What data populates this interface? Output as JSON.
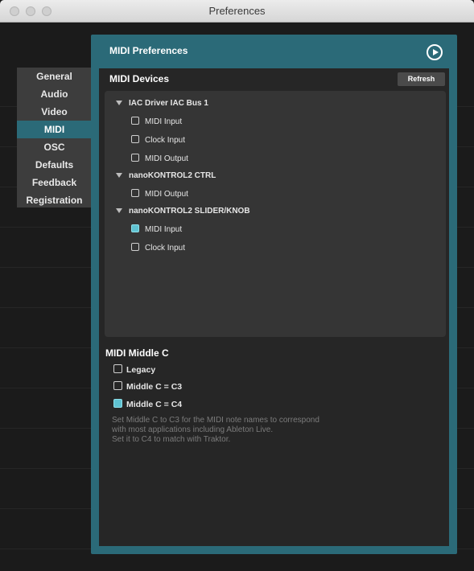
{
  "window": {
    "title": "Preferences"
  },
  "sidebar": {
    "items": [
      {
        "label": "General",
        "active": false
      },
      {
        "label": "Audio",
        "active": false
      },
      {
        "label": "Video",
        "active": false
      },
      {
        "label": "MIDI",
        "active": true
      },
      {
        "label": "OSC",
        "active": false
      },
      {
        "label": "Defaults",
        "active": false
      },
      {
        "label": "Feedback",
        "active": false
      },
      {
        "label": "Registration",
        "active": false
      }
    ]
  },
  "panel": {
    "title": "MIDI Preferences",
    "devices_label": "MIDI Devices",
    "refresh_label": "Refresh",
    "devices": [
      {
        "name": "IAC Driver IAC Bus 1",
        "options": [
          {
            "label": "MIDI Input",
            "checked": false
          },
          {
            "label": "Clock Input",
            "checked": false
          },
          {
            "label": "MIDI Output",
            "checked": false
          }
        ]
      },
      {
        "name": "nanoKONTROL2 CTRL",
        "options": [
          {
            "label": "MIDI Output",
            "checked": false
          }
        ]
      },
      {
        "name": "nanoKONTROL2 SLIDER/KNOB",
        "options": [
          {
            "label": "MIDI Input",
            "checked": true
          },
          {
            "label": "Clock Input",
            "checked": false
          }
        ]
      }
    ],
    "middle_c": {
      "title": "MIDI Middle C",
      "options": [
        {
          "label": "Legacy",
          "checked": false
        },
        {
          "label": "Middle C = C3",
          "checked": false
        },
        {
          "label": "Middle C = C4",
          "checked": true
        }
      ],
      "description": [
        "Set Middle C to C3 for the MIDI note names to correspond",
        "with most applications including Ableton Live.",
        "Set it to C4 to match with Traktor."
      ]
    }
  },
  "colors": {
    "accent": "#2b6a78",
    "checkbox_checked": "#5fc2d1"
  }
}
